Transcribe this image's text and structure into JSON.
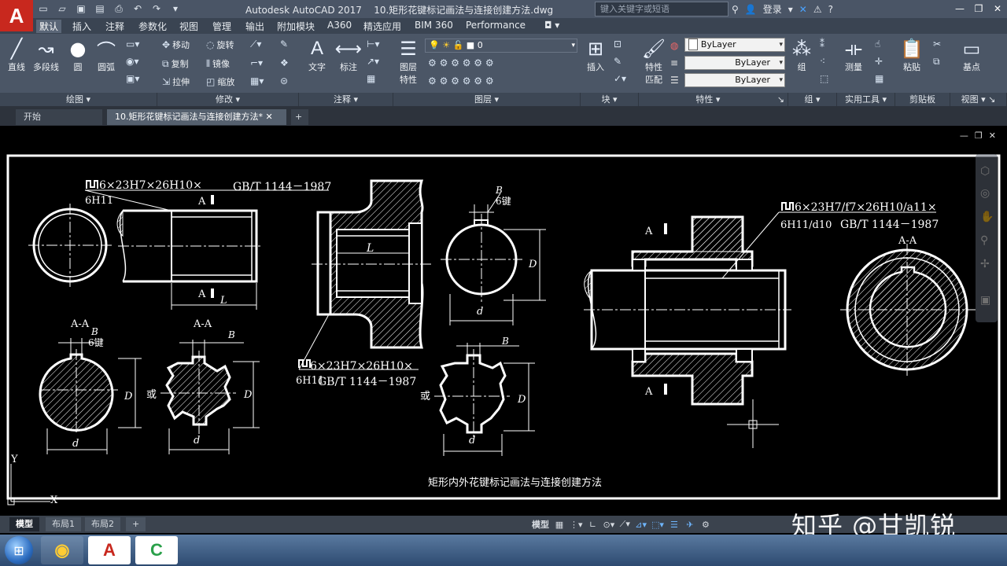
{
  "app": {
    "logo_letter": "A",
    "title": "Autodesk AutoCAD 2017",
    "filename": "10.矩形花键标记画法与连接创建方法.dwg",
    "search_placeholder": "键入关键字或短语",
    "login": "登录"
  },
  "menu": [
    "默认",
    "插入",
    "注释",
    "参数化",
    "视图",
    "管理",
    "输出",
    "附加模块",
    "A360",
    "精选应用",
    "BIM 360",
    "Performance"
  ],
  "ribbon": {
    "draw": {
      "line": "直线",
      "polyline": "多段线",
      "circle": "圆",
      "arc": "圆弧",
      "label": "绘图"
    },
    "modify": {
      "move": "移动",
      "rotate": "旋转",
      "copy": "复制",
      "mirror": "镜像",
      "stretch": "拉伸",
      "scale": "缩放",
      "label": "修改"
    },
    "annotation": {
      "text": "文字",
      "dimension": "标注",
      "label": "注释"
    },
    "layers": {
      "layer_props_1": "图层",
      "layer_props_2": "特性",
      "current_layer": "0",
      "label": "图层"
    },
    "block": {
      "insert": "插入",
      "label": "块"
    },
    "properties": {
      "match_1": "特性",
      "match_2": "匹配",
      "color": "ByLayer",
      "linetype": "ByLayer",
      "lineweight": "ByLayer",
      "label": "特性"
    },
    "groups": {
      "group": "组",
      "label": "组"
    },
    "utilities": {
      "measure": "测量",
      "label": "实用工具"
    },
    "clipboard": {
      "paste": "粘贴",
      "label": "剪贴板"
    },
    "view": {
      "base": "基点",
      "label": "视图"
    }
  },
  "doc_tabs": {
    "start": "开始",
    "current": "10.矩形花键标记画法与连接创建方法*"
  },
  "drawing": {
    "caption": "矩形内外花键标记画法与连接创建方法",
    "spec1_line1": "6×23H7×26H10×",
    "spec1_std": "GB/T 1144－1987",
    "spec1_line2": "6H11",
    "spec2_line1": "6×23H7×26H10×",
    "spec2_line2": "6H11",
    "spec2_std": "GB/T 1144－1987",
    "spec3_line1": "6×23H7/f7×26H10/a11×",
    "spec3_line2": "6H11/d10",
    "spec3_std": "GB/T 1144－1987",
    "section_aa": "A-A",
    "label_a": "A",
    "label_b": "B",
    "label_l": "L",
    "label_d": "d",
    "label_D": "D",
    "key6": "6键",
    "or": "或",
    "ucs_y": "Y",
    "ucs_x": "X"
  },
  "layout_tabs": [
    "模型",
    "布局1",
    "布局2"
  ],
  "status": {
    "model": "模型"
  },
  "watermark": "知乎 @甘凯锐"
}
